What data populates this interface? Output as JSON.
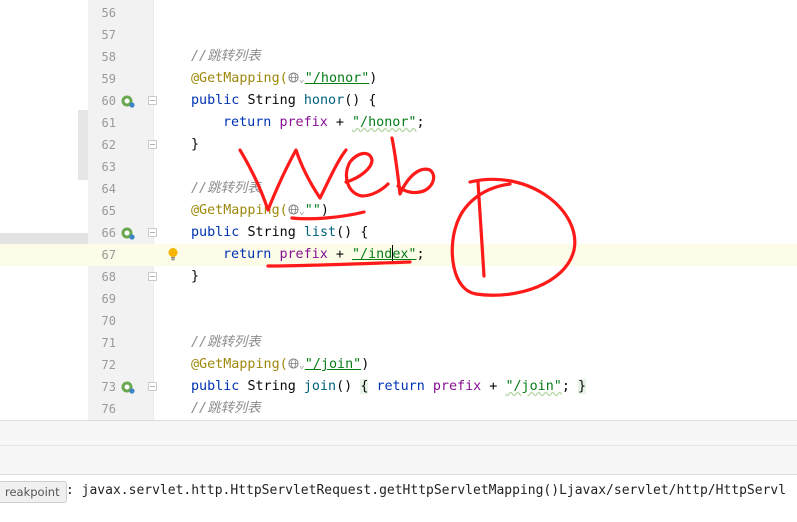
{
  "editor": {
    "lines": [
      {
        "num": "56"
      },
      {
        "num": "57"
      },
      {
        "num": "58",
        "comment": "//跳转列表"
      },
      {
        "num": "59",
        "annotation": "@GetMapping(",
        "path": "\"/honor\"",
        "close": ")"
      },
      {
        "num": "60",
        "kw": "public",
        "type": "String",
        "method": "honor",
        "sig": "() {"
      },
      {
        "num": "61",
        "kw": "return",
        "field": "prefix",
        "op": " + ",
        "str": "\"/honor\"",
        "end": ";"
      },
      {
        "num": "62",
        "text": "}"
      },
      {
        "num": "63"
      },
      {
        "num": "64",
        "comment": "//跳转列表"
      },
      {
        "num": "65",
        "annotation": "@GetMapping(",
        "path": "\"\"",
        "close": ")"
      },
      {
        "num": "66",
        "kw": "public",
        "type": "String",
        "method": "list",
        "sig": "() {"
      },
      {
        "num": "67",
        "kw": "return",
        "field": "prefix",
        "op": " + ",
        "str_a": "\"/ind",
        "str_b": "ex\"",
        "end": ";"
      },
      {
        "num": "68",
        "text": "}"
      },
      {
        "num": "69"
      },
      {
        "num": "70"
      },
      {
        "num": "71",
        "comment": "//跳转列表"
      },
      {
        "num": "72",
        "annotation": "@GetMapping(",
        "path": "\"/join\"",
        "close": ")"
      },
      {
        "num": "73",
        "kw": "public",
        "type": "String",
        "method": "join",
        "sig_a": "() ",
        "brace_open": "{",
        "kw2": "return",
        "field": "prefix",
        "op": " + ",
        "str": "\"/join\"",
        "end": ";",
        "brace_close": "}"
      },
      {
        "num": "76",
        "comment": "//跳转列表"
      }
    ]
  },
  "status": {
    "label": "reakpoint",
    "message": ": javax.servlet.http.HttpServletRequest.getHttpServletMapping()Ljavax/servlet/http/HttpServl"
  },
  "icons": {
    "gutter_method": "spring-web-endpoint-icon",
    "intention": "lightbulb-icon",
    "fold": "fold-marker-icon",
    "globe": "globe-icon"
  },
  "colors": {
    "keyword": "#0033b3",
    "annotation": "#9e880d",
    "string": "#067d17",
    "field": "#871094",
    "comment": "#8c8c8c",
    "ink": "#ff1a1a"
  }
}
